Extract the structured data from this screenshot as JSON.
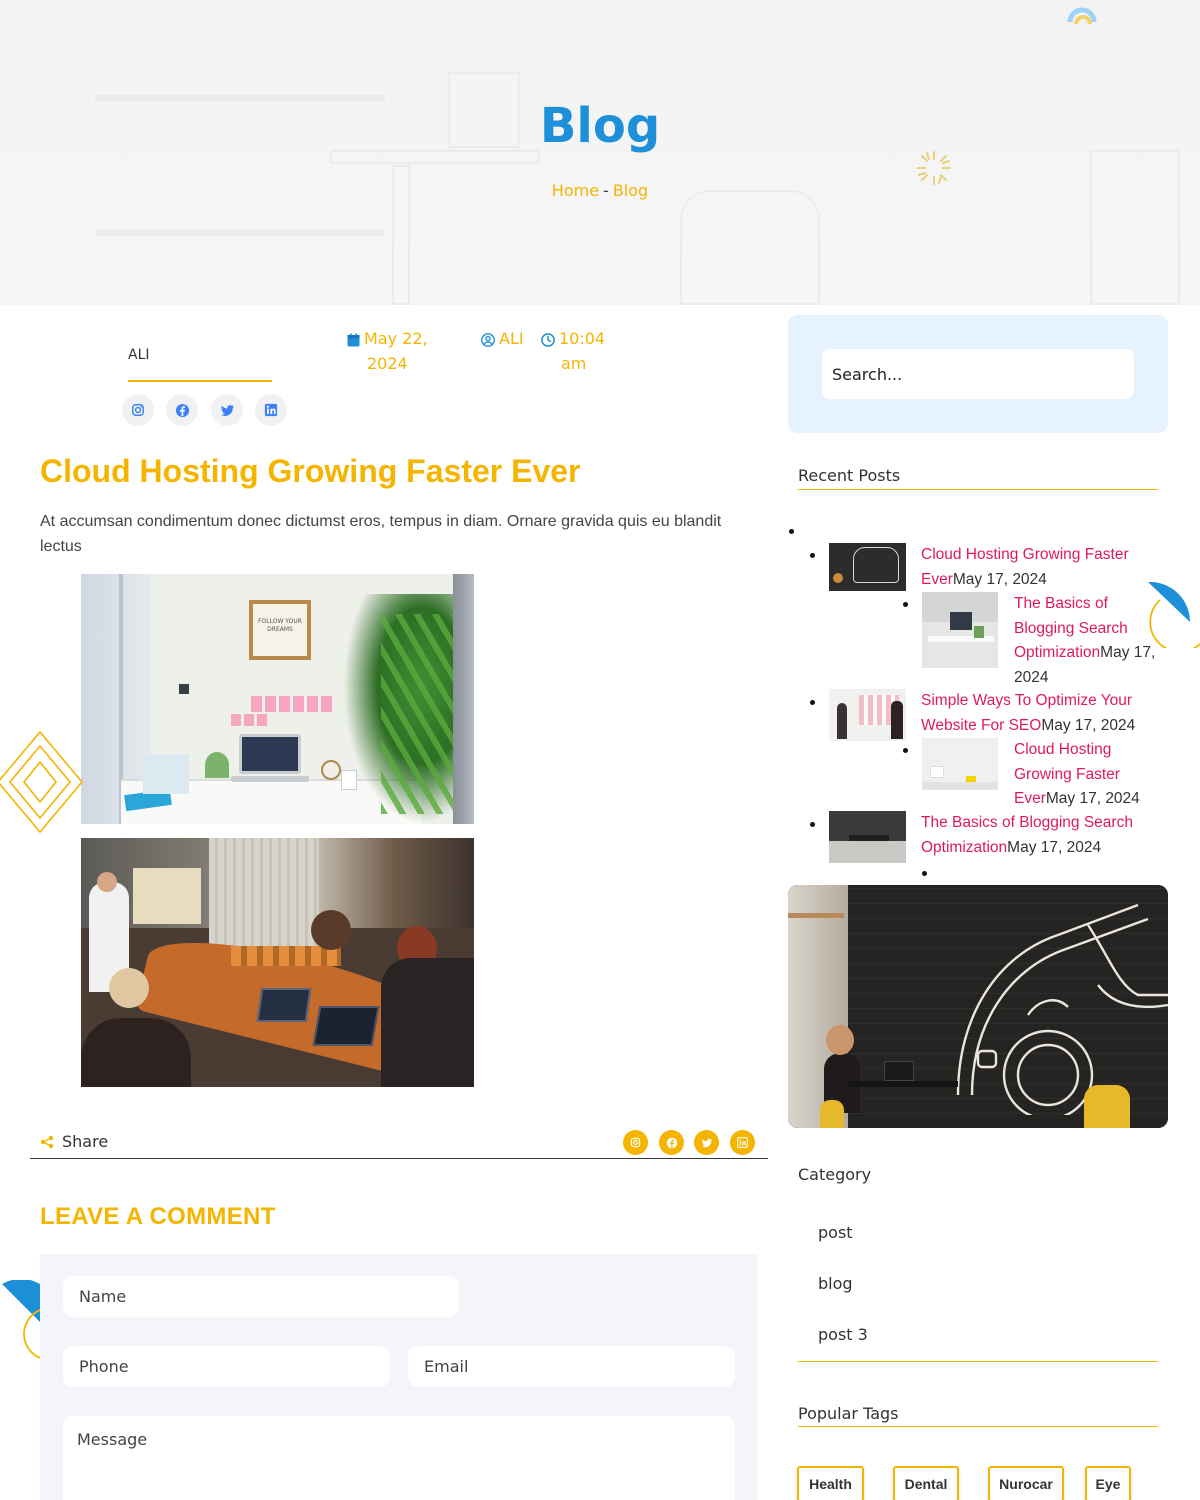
{
  "hero": {
    "title": "Blog",
    "breadcrumb": {
      "home": "Home",
      "separator": "-",
      "current": "Blog"
    }
  },
  "author": {
    "name": "ALI",
    "social_icons": [
      "instagram-icon",
      "facebook-icon",
      "twitter-icon",
      "linkedin-icon"
    ]
  },
  "meta": {
    "date_line1": "May 22,",
    "date_line2": "2024",
    "author": "ALI",
    "time_line1": "10:04",
    "time_line2": "am"
  },
  "post": {
    "title": "Cloud Hosting Growing Faster Ever",
    "excerpt": "At accumsan condimentum donec dictumst eros, tempus in diam. Ornare gravida quis eu blandit lectus",
    "frame_text": "FOLLOW YOUR DREAMS"
  },
  "share": {
    "label": "Share",
    "icons": [
      "instagram-icon",
      "facebook-icon",
      "twitter-icon",
      "linkedin-icon"
    ]
  },
  "comment": {
    "title": "LEAVE A COMMENT",
    "name_placeholder": "Name",
    "phone_placeholder": "Phone",
    "email_placeholder": "Email",
    "message_placeholder": "Message"
  },
  "sidebar": {
    "search_placeholder": "Search...",
    "recent_title": "Recent Posts",
    "recent_posts": [
      {
        "l1": "Cloud Hosting Growing Faster",
        "l2": "Ever",
        "d2": "May 17, 2024"
      },
      {
        "l1": "The Basics of",
        "l2": "Blogging Search",
        "l3": "Optimization",
        "d3": "May 17,",
        "d4": "2024"
      },
      {
        "l1": "Simple Ways To Optimize Your",
        "l2": "Website For SEO",
        "d2": "May 17, 2024"
      },
      {
        "l1": "Cloud Hosting",
        "l2": "Growing Faster",
        "l3": "Ever",
        "d3": "May 17, 2024"
      },
      {
        "l1": "The Basics of Blogging Search",
        "l2": "Optimization",
        "d2": "May 17, 2024"
      }
    ],
    "category_title": "Category",
    "categories": [
      "post",
      "blog",
      "post 3"
    ],
    "tags_title": "Popular Tags",
    "tags": [
      "Health",
      "Dental",
      "Nurocar",
      "Eye"
    ]
  },
  "colors": {
    "accent": "#f5b400",
    "primary": "#1e8fd9",
    "link": "#e0195f"
  }
}
